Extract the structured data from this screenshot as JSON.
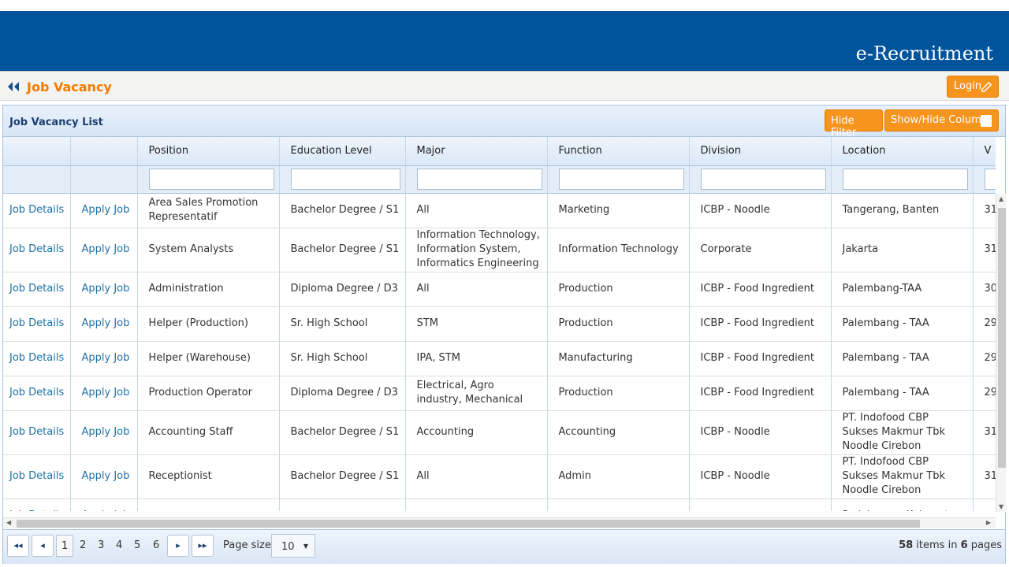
{
  "app": {
    "title": "e-Recruitment"
  },
  "page": {
    "title": "Job Vacancy",
    "login_label": "Login"
  },
  "panel": {
    "title": "Job Vacancy List",
    "hide_filter_label": "Hide Filter",
    "show_hide_column_label": "Show/Hide Column"
  },
  "table": {
    "columns": [
      "Position",
      "Education Level",
      "Major",
      "Function",
      "Division",
      "Location",
      "V"
    ],
    "rows": [
      {
        "job_details": "Job Details",
        "apply": "Apply Job",
        "position": "Area Sales Promotion Representatif",
        "education": "Bachelor Degree / S1",
        "major": "All",
        "function": "Marketing",
        "division": "ICBP - Noodle",
        "location": "Tangerang, Banten",
        "v": "31"
      },
      {
        "job_details": "Job Details",
        "apply": "Apply Job",
        "position": "System Analysts",
        "education": "Bachelor Degree / S1",
        "major": "Information Technology, Information System, Informatics Engineering",
        "function": "Information Technology",
        "division": "Corporate",
        "location": "Jakarta",
        "v": "31"
      },
      {
        "job_details": "Job Details",
        "apply": "Apply Job",
        "position": "Administration",
        "education": "Diploma Degree / D3",
        "major": "All",
        "function": "Production",
        "division": "ICBP - Food Ingredient",
        "location": "Palembang-TAA",
        "v": "30"
      },
      {
        "job_details": "Job Details",
        "apply": "Apply Job",
        "position": "Helper (Production)",
        "education": "Sr. High School",
        "major": "STM",
        "function": "Production",
        "division": "ICBP - Food Ingredient",
        "location": "Palembang - TAA",
        "v": "29"
      },
      {
        "job_details": "Job Details",
        "apply": "Apply Job",
        "position": "Helper (Warehouse)",
        "education": "Sr. High School",
        "major": "IPA, STM",
        "function": "Manufacturing",
        "division": "ICBP - Food Ingredient",
        "location": "Palembang - TAA",
        "v": "29"
      },
      {
        "job_details": "Job Details",
        "apply": "Apply Job",
        "position": "Production Operator",
        "education": "Diploma Degree / D3",
        "major": "Electrical, Agro industry, Mechanical",
        "function": "Production",
        "division": "ICBP - Food Ingredient",
        "location": "Palembang - TAA",
        "v": "29"
      },
      {
        "job_details": "Job Details",
        "apply": "Apply Job",
        "position": "Accounting Staff",
        "education": "Bachelor Degree / S1",
        "major": "Accounting",
        "function": "Accounting",
        "division": "ICBP - Noodle",
        "location": "PT. Indofood CBP Sukses Makmur Tbk Noodle Cirebon",
        "v": "31"
      },
      {
        "job_details": "Job Details",
        "apply": "Apply Job",
        "position": "Receptionist",
        "education": "Bachelor Degree / S1",
        "major": "All",
        "function": "Admin",
        "division": "ICBP - Noodle",
        "location": "PT. Indofood CBP Sukses Makmur Tbk Noodle Cirebon",
        "v": "31"
      },
      {
        "job_details": "Job Details",
        "apply": "Apply Job",
        "position": "",
        "education": "",
        "major": "",
        "function": "",
        "division": "",
        "location": "Padalarang, Kabupaten",
        "v": ""
      }
    ]
  },
  "pager": {
    "first": "◂◂",
    "prev": "◂",
    "next": "▸",
    "last": "▸▸",
    "pages": [
      "1",
      "2",
      "3",
      "4",
      "5",
      "6"
    ],
    "page_size_label": "Page size:",
    "page_size": "10",
    "items_count": "58",
    "items_mid": " items in ",
    "pages_count": "6",
    "pages_suffix": " pages"
  }
}
